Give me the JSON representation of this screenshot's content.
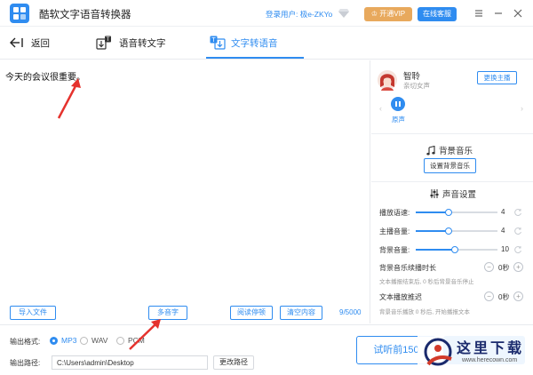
{
  "titlebar": {
    "app_title": "酷软文字语音转换器",
    "user_label": "登录用户: 极e-ZKYo",
    "vip_label": "开通VIP",
    "service_label": "在线客服"
  },
  "tabs": {
    "back": "返回",
    "speech_to_text": "语音转文字",
    "text_to_speech": "文字转语音"
  },
  "editor": {
    "content": "今天的会议很重要。",
    "char_count": "9/5000"
  },
  "toolbar": {
    "import_file": "导入文件",
    "polyphone": "多音字",
    "pause": "阅读停顿",
    "clear": "清空内容"
  },
  "output": {
    "format_label": "输出格式:",
    "formats": [
      "MP3",
      "WAV",
      "PCM"
    ],
    "selected_format": "MP3",
    "path_label": "输出路径:",
    "path_value": "C:\\Users\\admin\\Desktop",
    "change_path": "更改路径",
    "preview_button": "试听前150"
  },
  "voice": {
    "name": "智聆",
    "desc": "亲切女声",
    "switch_anchor": "更换主播",
    "play_label": "原声"
  },
  "bgm": {
    "title": "背景音乐",
    "set_button": "设置背景音乐"
  },
  "sound": {
    "title": "声音设置",
    "speed_label": "播放语速:",
    "speed_value": "4",
    "speed_fraction": 0.4,
    "volume_label": "主播音量:",
    "volume_value": "4",
    "volume_fraction": 0.4,
    "bgm_volume_label": "背景音量:",
    "bgm_volume_value": "10",
    "bgm_volume_fraction": 0.48,
    "bgm_extend_label": "背景音乐续播时长",
    "bgm_extend_value": "0秒",
    "bgm_extend_hint": "文本播报结束后, 0 秒后背景音乐停止",
    "delay_label": "文本播放推迟",
    "delay_value": "0秒",
    "delay_hint": "背景音乐播放 0 秒后, 开始播报文本"
  },
  "watermark": {
    "text": "这里下载",
    "url": "www.herecown.com"
  },
  "colors": {
    "accent": "#2f8cf0",
    "vip": "#e8a95d",
    "arrow": "#e5322d"
  }
}
